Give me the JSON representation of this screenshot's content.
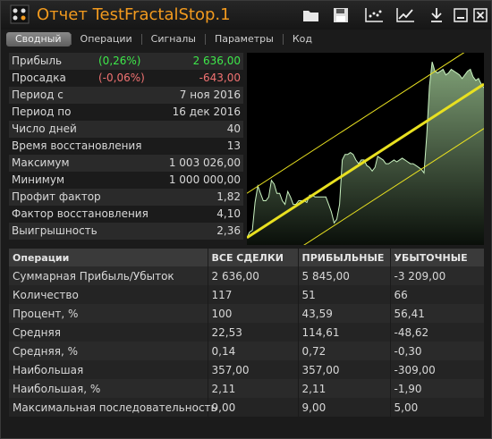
{
  "window": {
    "title": "Отчет TestFractalStop.1",
    "toolbar_buttons": [
      "folder-open-icon",
      "save-icon",
      "chart-settings-icon",
      "equity-chart-icon",
      "download-icon",
      "minimize-icon",
      "close-icon"
    ]
  },
  "tabs": [
    {
      "label": "Сводный",
      "active": true
    },
    {
      "label": "Операции",
      "active": false
    },
    {
      "label": "Сигналы",
      "active": false
    },
    {
      "label": "Параметры",
      "active": false
    },
    {
      "label": "Код",
      "active": false
    }
  ],
  "summary": [
    {
      "label": "Прибыль",
      "pct": "(0,26%)",
      "value": "2 636,00",
      "color": "positive"
    },
    {
      "label": "Просадка",
      "pct": "(-0,06%)",
      "value": "-643,00",
      "color": "negative"
    },
    {
      "label": "Период с",
      "pct": "",
      "value": "7 ноя 2016"
    },
    {
      "label": "Период по",
      "pct": "",
      "value": "16 дек 2016"
    },
    {
      "label": "Число дней",
      "pct": "",
      "value": "40"
    },
    {
      "label": "Время восстановления",
      "pct": "",
      "value": "13"
    },
    {
      "label": "Максимум",
      "pct": "",
      "value": "1 003 026,00"
    },
    {
      "label": "Минимум",
      "pct": "",
      "value": "1 000 000,00"
    },
    {
      "label": "Профит фактор",
      "pct": "",
      "value": "1,82"
    },
    {
      "label": "Фактор восстановления",
      "pct": "",
      "value": "4,10"
    },
    {
      "label": "Выигрышность",
      "pct": "",
      "value": "2,36"
    }
  ],
  "colors": {
    "positive": "#3ee84a",
    "negative": "#f07272",
    "accent": "#f29a1e",
    "channel": "#e8e020"
  },
  "operations": {
    "headers": [
      "Операции",
      "ВСЕ СДЕЛКИ",
      "ПРИБЫЛЬНЫЕ",
      "УБЫТОЧНЫЕ"
    ],
    "rows": [
      [
        "Суммарная Прибыль/Убыток",
        "2 636,00",
        "5 845,00",
        "-3 209,00"
      ],
      [
        "Количество",
        "117",
        "51",
        "66"
      ],
      [
        "Процент, %",
        "100",
        "43,59",
        "56,41"
      ],
      [
        "Средняя",
        "22,53",
        "114,61",
        "-48,62"
      ],
      [
        "Средняя, %",
        "0,14",
        "0,72",
        "-0,30"
      ],
      [
        "Наибольшая",
        "357,00",
        "357,00",
        "-309,00"
      ],
      [
        "Наибольшая, %",
        "2,11",
        "2,11",
        "-1,90"
      ],
      [
        "Максимальная последовательность",
        "9,00",
        "9,00",
        "5,00"
      ]
    ]
  },
  "equity_chart": {
    "values": [
      0.02,
      0.05,
      0.06,
      0.21,
      0.3,
      0.26,
      0.22,
      0.22,
      0.24,
      0.33,
      0.31,
      0.26,
      0.26,
      0.22,
      0.2,
      0.27,
      0.24,
      0.2,
      0.2,
      0.22,
      0.22,
      0.22,
      0.21,
      0.25,
      0.25,
      0.24,
      0.24,
      0.24,
      0.24,
      0.24,
      0.2,
      0.16,
      0.1,
      0.12,
      0.2,
      0.44,
      0.47,
      0.47,
      0.48,
      0.47,
      0.44,
      0.42,
      0.44,
      0.44,
      0.41,
      0.4,
      0.38,
      0.4,
      0.46,
      0.45,
      0.44,
      0.42,
      0.42,
      0.43,
      0.44,
      0.43,
      0.44,
      0.45,
      0.44,
      0.43,
      0.42,
      0.42,
      0.41,
      0.4,
      0.39,
      0.37,
      0.57,
      0.84,
      0.97,
      0.92,
      0.91,
      0.92,
      0.93,
      0.9,
      0.91,
      0.93,
      0.92,
      0.91,
      0.9,
      0.88,
      0.9,
      0.92,
      0.93,
      0.89,
      0.87,
      0.88,
      0.85,
      0.83
    ],
    "channel_mid": [
      0.02,
      0.85
    ],
    "channel_offset": 0.24
  }
}
